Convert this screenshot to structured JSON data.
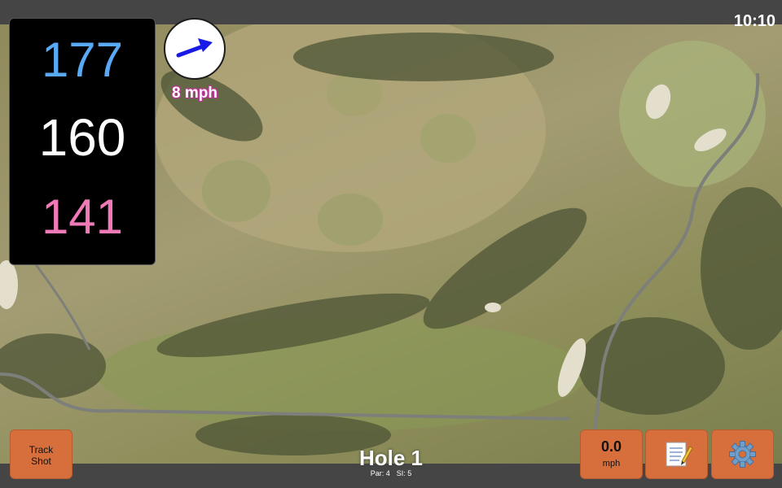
{
  "status": {
    "time": "10:10"
  },
  "distances": {
    "back": "177",
    "middle": "160",
    "front": "141"
  },
  "wind": {
    "speed": "8 mph",
    "icon": "wind-direction-arrow-icon"
  },
  "hole": {
    "title": "Hole 1",
    "par": "Par: 4",
    "stroke_index": "SI: 5"
  },
  "buttons": {
    "track_shot": {
      "line1": "Track",
      "line2": "Shot"
    },
    "speed": {
      "value": "0.0",
      "unit": "mph"
    },
    "notes_icon": "notepad-icon",
    "settings_icon": "gear-icon"
  },
  "colors": {
    "back": "#5aa9f5",
    "middle": "#ffffff",
    "front": "#f07ab7",
    "button": "#d66f3c",
    "wind_arrow": "#1a1ae6"
  }
}
